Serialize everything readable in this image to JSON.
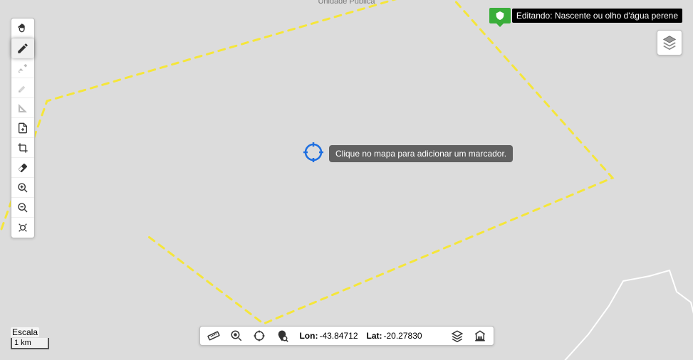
{
  "top_partial_label": "Unidade Pública",
  "edit_badge": {
    "text": "Editando: Nascente ou olho d'água perene"
  },
  "tooltip": "Clique no mapa para adicionar um marcador.",
  "scale": {
    "label": "Escala",
    "value": "1 km"
  },
  "coords": {
    "lon_label": "Lon:",
    "lon_value": "-43.84712",
    "lat_label": "Lat:",
    "lat_value": "-20.27830"
  },
  "icons": {
    "pan": "pan-icon",
    "draw": "draw-icon",
    "edit_vertex": "edit-vertex-icon",
    "edit_line": "edit-line-icon",
    "measure_angle": "measure-angle-icon",
    "add_file": "add-file-icon",
    "crop": "crop-icon",
    "erase": "erase-icon",
    "zoom_in": "zoom-in-icon",
    "zoom_out": "zoom-out-icon",
    "zoom_extent": "zoom-extent-icon",
    "ruler": "ruler-icon",
    "zoom_point": "zoom-point-icon",
    "target": "target-icon",
    "search_map": "search-map-icon",
    "layers": "layers-icon",
    "institution": "institution-icon"
  }
}
